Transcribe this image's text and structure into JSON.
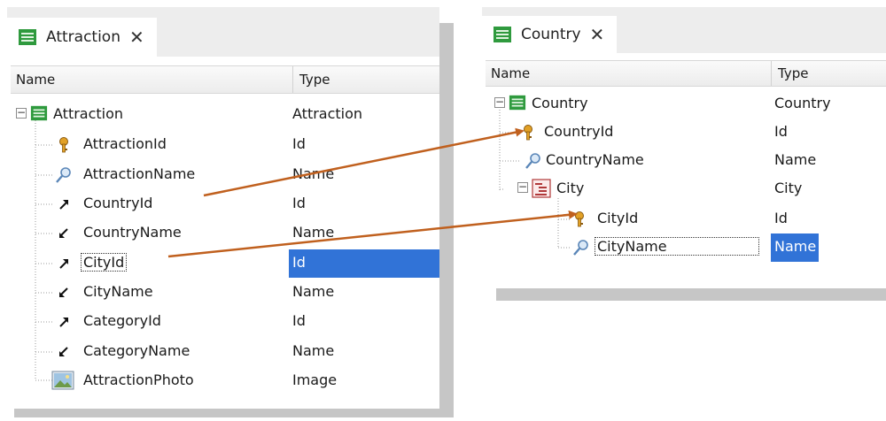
{
  "attraction_window": {
    "tab_title": "Attraction",
    "close_glyph": "✕",
    "headers": {
      "name": "Name",
      "type": "Type"
    },
    "root": {
      "name": "Attraction",
      "type": "Attraction"
    },
    "rows": [
      {
        "name": "AttractionId",
        "type": "Id",
        "icon": "key-icon"
      },
      {
        "name": "AttractionName",
        "type": "Name",
        "icon": "magnifier-icon"
      },
      {
        "name": "CountryId",
        "type": "Id",
        "icon": "inferred-out-icon"
      },
      {
        "name": "CountryName",
        "type": "Name",
        "icon": "inferred-in-icon"
      },
      {
        "name": "CityId",
        "type": "Id",
        "icon": "inferred-out-icon",
        "selected": true
      },
      {
        "name": "CityName",
        "type": "Name",
        "icon": "inferred-in-icon"
      },
      {
        "name": "CategoryId",
        "type": "Id",
        "icon": "inferred-out-icon"
      },
      {
        "name": "CategoryName",
        "type": "Name",
        "icon": "inferred-in-icon"
      },
      {
        "name": "AttractionPhoto",
        "type": "Image",
        "icon": "image-icon"
      }
    ]
  },
  "country_window": {
    "tab_title": "Country",
    "close_glyph": "✕",
    "headers": {
      "name": "Name",
      "type": "Type"
    },
    "root": {
      "name": "Country",
      "type": "Country"
    },
    "rows": [
      {
        "name": "CountryId",
        "type": "Id",
        "icon": "key-icon"
      },
      {
        "name": "CountryName",
        "type": "Name",
        "icon": "magnifier-icon"
      },
      {
        "name": "City",
        "type": "City",
        "icon": "level-icon"
      },
      {
        "name": "CityId",
        "type": "Id",
        "icon": "key-icon"
      },
      {
        "name": "CityName",
        "type": "Name",
        "icon": "magnifier-icon",
        "selected": true
      }
    ]
  },
  "colors": {
    "selection": "#3173d7",
    "arrow": "#c0601e",
    "tab_strip": "#ededed",
    "shadow": "#c6c6c6"
  }
}
